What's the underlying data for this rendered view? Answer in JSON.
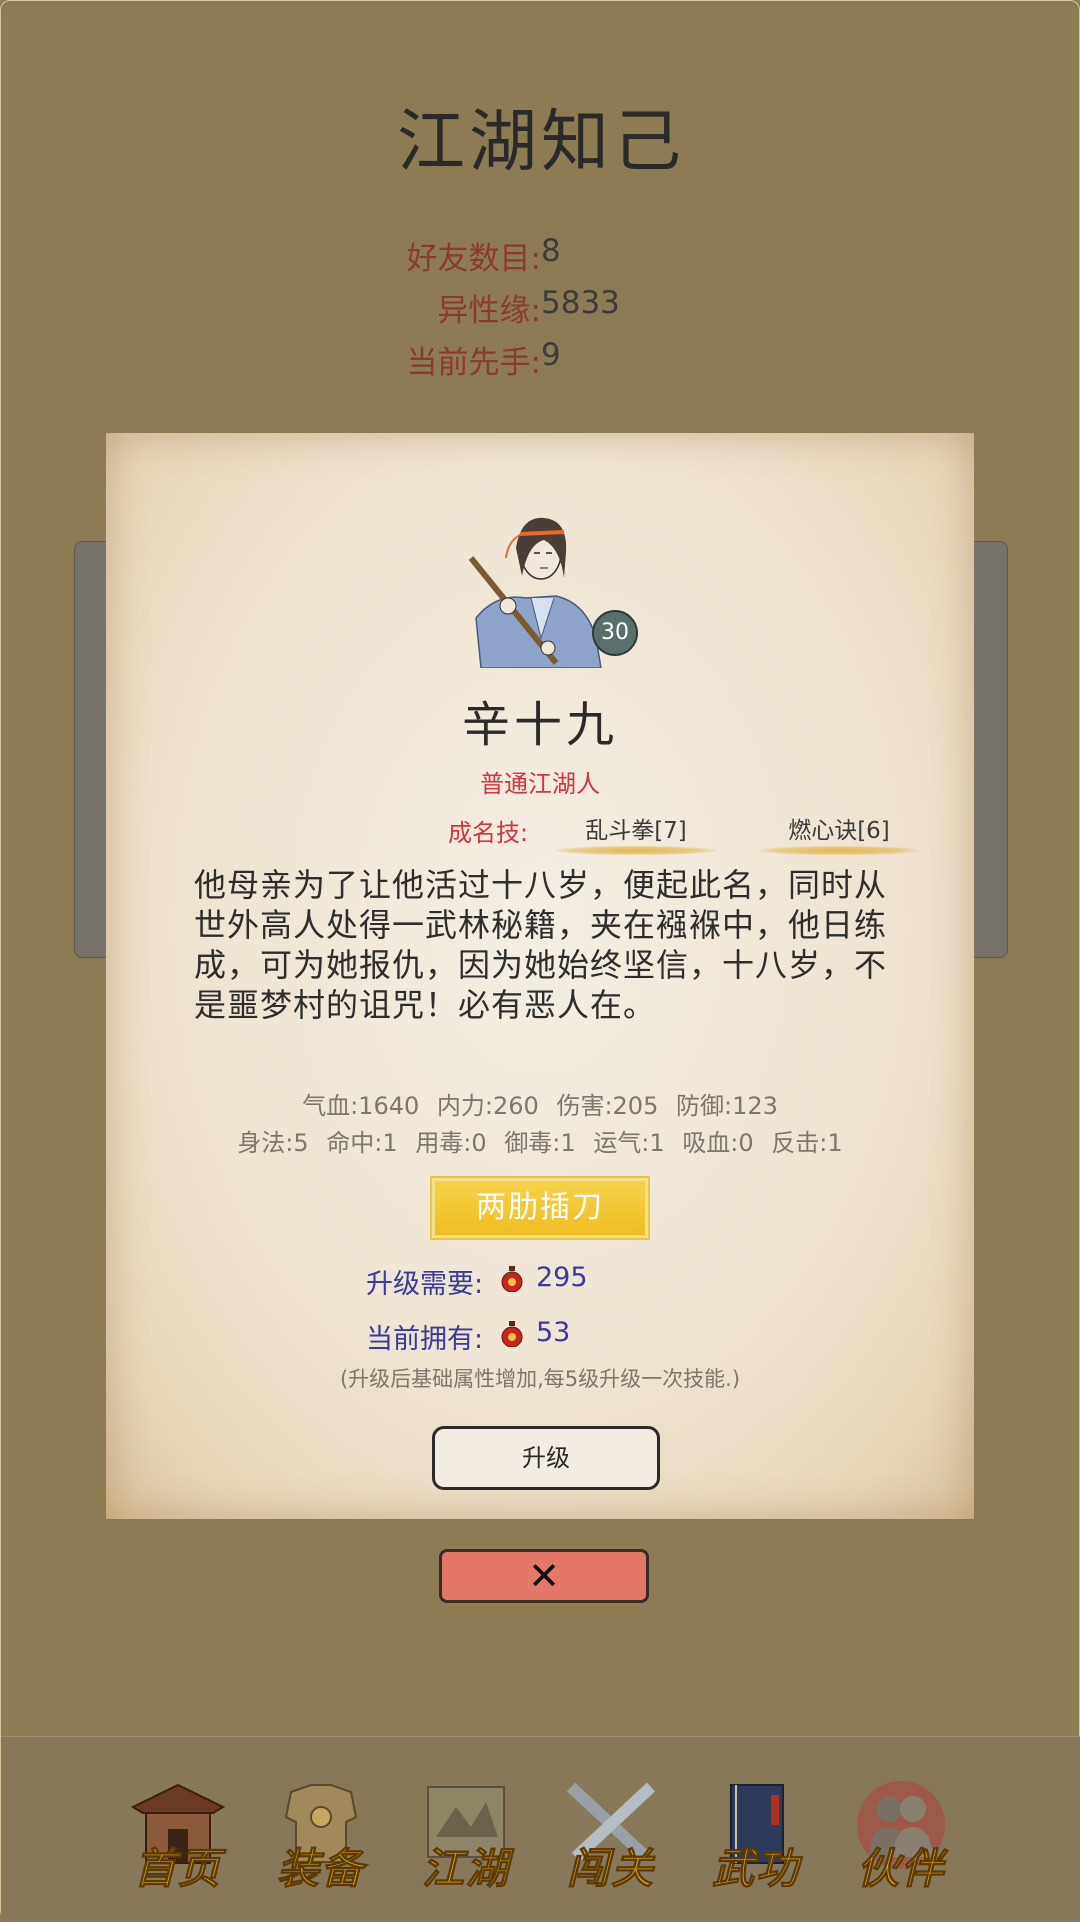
{
  "header": {
    "title": "江湖知己"
  },
  "stats": [
    {
      "label": "好友数目",
      "value": "8"
    },
    {
      "label": "异性缘",
      "value": "5833"
    },
    {
      "label": "当前先手",
      "value": "9"
    }
  ],
  "hero": {
    "level": "30",
    "name": "辛十九",
    "rank": "普通江湖人",
    "skills_label": "成名技:",
    "skills": [
      "乱斗拳[7]",
      "燃心诀[6]"
    ],
    "bio": "他母亲为了让他活过十八岁，便起此名，同时从世外高人处得一武林秘籍，夹在襁褓中，他日练成，可为她报仇，因为她始终坚信，十八岁，不是噩梦村的诅咒！必有恶人在。",
    "attributes_row1": [
      "气血:1640",
      "内力:260",
      "伤害:205",
      "防御:123"
    ],
    "attributes_row2": [
      "身法:5",
      "命中:1",
      "用毒:0",
      "御毒:1",
      "运气:1",
      "吸血:0",
      "反击:1"
    ],
    "ability": "两肋插刀",
    "upgrade_need_label": "升级需要:",
    "upgrade_need_value": "295",
    "current_have_label": "当前拥有:",
    "current_have_value": "53",
    "note": "(升级后基础属性增加,每5级升级一次技能.)",
    "upgrade_button": "升级"
  },
  "close_symbol": "✕",
  "nav": [
    {
      "label": "首页",
      "icon": "house-icon"
    },
    {
      "label": "装备",
      "icon": "armor-icon"
    },
    {
      "label": "江湖",
      "icon": "scroll-map-icon"
    },
    {
      "label": "闯关",
      "icon": "crossed-swords-icon"
    },
    {
      "label": "武功",
      "icon": "book-icon"
    },
    {
      "label": "伙伴",
      "icon": "companions-icon"
    }
  ],
  "colors": {
    "background": "#8d7b54",
    "accent_red": "#d2353f",
    "gold": "#d7a020",
    "close_red": "#e57766"
  }
}
